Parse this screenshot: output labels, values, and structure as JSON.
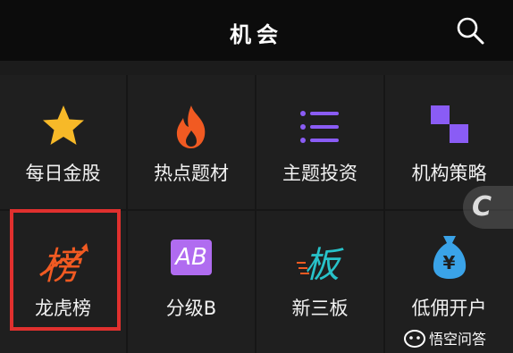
{
  "header": {
    "title": "机会"
  },
  "grid": {
    "items": [
      {
        "label": "每日金股",
        "icon": "star-icon"
      },
      {
        "label": "热点题材",
        "icon": "flame-icon"
      },
      {
        "label": "主题投资",
        "icon": "list-icon"
      },
      {
        "label": "机构策略",
        "icon": "checker-icon"
      },
      {
        "label": "龙虎榜",
        "icon": "bang-icon",
        "icon_text": "榜"
      },
      {
        "label": "分级B",
        "icon": "ab-icon",
        "icon_text": "AB"
      },
      {
        "label": "新三板",
        "icon": "ban-icon",
        "icon_text": "板"
      },
      {
        "label": "低佣开户",
        "icon": "money-bag-icon",
        "icon_text": "¥"
      }
    ]
  },
  "float_button": {
    "letter": "C"
  },
  "watermark": {
    "text": "悟空问答"
  },
  "colors": {
    "accent_orange": "#f15a22",
    "star": "#f7b928",
    "purple": "#8a5cf5",
    "teal": "#28c2c9",
    "highlight_red": "#e0302e"
  }
}
